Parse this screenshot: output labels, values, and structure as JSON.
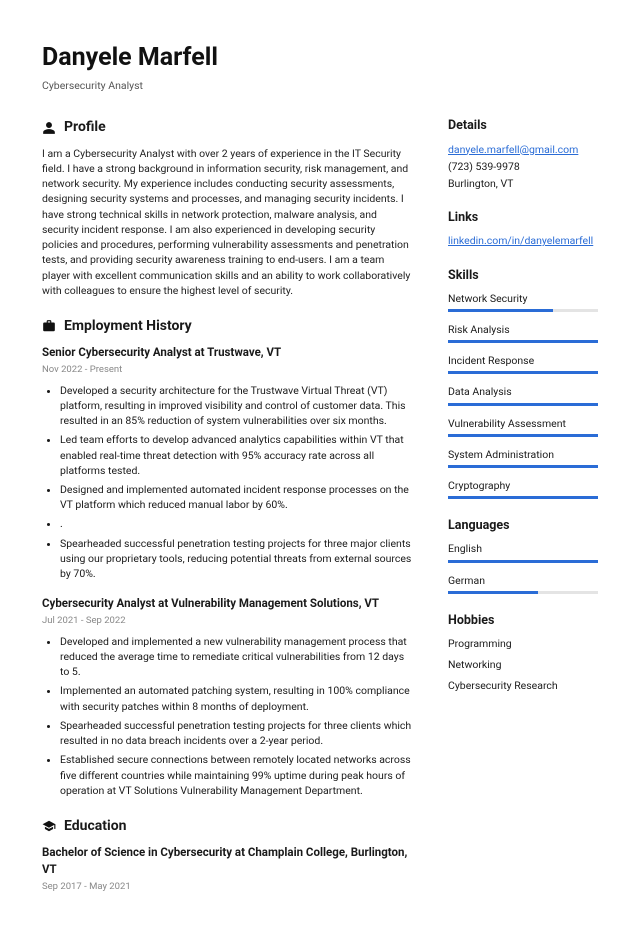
{
  "header": {
    "name": "Danyele Marfell",
    "role": "Cybersecurity Analyst"
  },
  "profile": {
    "title": "Profile",
    "text": "I am a Cybersecurity Analyst with over 2 years of experience in the IT Security field. I have a strong background in information security, risk management, and network security. My experience includes conducting security assessments, designing security systems and processes, and managing security incidents. I have strong technical skills in network protection, malware analysis, and security incident response. I am also experienced in developing security policies and procedures, performing vulnerability assessments and penetration tests, and providing security awareness training to end-users. I am a team player with excellent communication skills and an ability to work collaboratively with colleagues to ensure the highest level of security."
  },
  "employment": {
    "title": "Employment History",
    "jobs": [
      {
        "title": "Senior Cybersecurity Analyst at Trustwave, VT",
        "dates": "Nov 2022 - Present",
        "bullets": [
          "Developed a security architecture for the Trustwave Virtual Threat (VT) platform, resulting in improved visibility and control of customer data. This resulted in an 85% reduction of system vulnerabilities over six months.",
          "Led team efforts to develop advanced analytics capabilities within VT that enabled real-time threat detection with 95% accuracy rate across all platforms tested.",
          "Designed and implemented automated incident response processes on the VT platform which reduced manual labor by 60%.",
          ".",
          "Spearheaded successful penetration testing projects for three major clients using our proprietary tools, reducing potential threats from external sources by 70%."
        ]
      },
      {
        "title": "Cybersecurity Analyst at Vulnerability Management Solutions, VT",
        "dates": "Jul 2021 - Sep 2022",
        "bullets": [
          "Developed and implemented a new vulnerability management process that reduced the average time to remediate critical vulnerabilities from 12 days to 5.",
          "Implemented an automated patching system, resulting in 100% compliance with security patches within 8 months of deployment.",
          "Spearheaded successful penetration testing projects for three clients which resulted in no data breach incidents over a 2-year period.",
          "Established secure connections between remotely located networks across five different countries while maintaining 99% uptime during peak hours of operation at VT Solutions Vulnerability Management Department."
        ]
      }
    ]
  },
  "education": {
    "title": "Education",
    "items": [
      {
        "title": "Bachelor of Science in Cybersecurity at Champlain College, Burlington, VT",
        "dates": "Sep 2017 - May 2021"
      }
    ]
  },
  "details": {
    "title": "Details",
    "email": "danyele.marfell@gmail.com",
    "phone": "(723) 539-9978",
    "location": "Burlington, VT"
  },
  "links": {
    "title": "Links",
    "items": [
      {
        "text": "linkedin.com/in/danyelemarfell"
      }
    ]
  },
  "skills": {
    "title": "Skills",
    "items": [
      {
        "name": "Network Security",
        "pct": 70
      },
      {
        "name": "Risk Analysis",
        "pct": 100
      },
      {
        "name": "Incident Response",
        "pct": 100
      },
      {
        "name": "Data Analysis",
        "pct": 100
      },
      {
        "name": "Vulnerability Assessment",
        "pct": 100
      },
      {
        "name": "System Administration",
        "pct": 100
      },
      {
        "name": "Cryptography",
        "pct": 100
      }
    ]
  },
  "languages": {
    "title": "Languages",
    "items": [
      {
        "name": "English",
        "pct": 100
      },
      {
        "name": "German",
        "pct": 60
      }
    ]
  },
  "hobbies": {
    "title": "Hobbies",
    "items": [
      "Programming",
      "Networking",
      "Cybersecurity Research"
    ]
  }
}
